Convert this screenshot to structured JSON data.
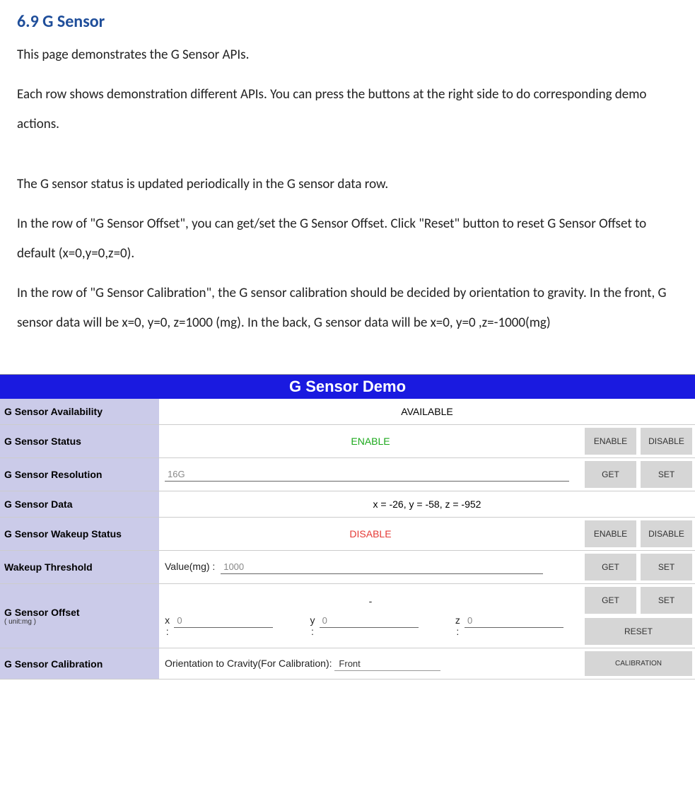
{
  "doc": {
    "heading": "6.9 G Sensor",
    "p1": "This page demonstrates the G Sensor APIs.",
    "p2": "Each row shows demonstration different APIs. You can press the buttons at the right side to do corresponding demo actions.",
    "p3": "The G sensor status is updated periodically in the G sensor data row.",
    "p4": "In the row of \"G Sensor Offset\", you can get/set the G Sensor Offset. Click \"Reset\" button to reset G Sensor Offset to default (x=0,y=0,z=0).",
    "p5": "In the row of \"G Sensor Calibration\", the G sensor calibration should be decided by orientation to gravity. In the front, G sensor data will be x=0, y=0, z=1000 (mg). In the back, G sensor data will be x=0, y=0 ,z=-1000(mg)"
  },
  "demo": {
    "title": "G Sensor Demo",
    "rows": {
      "availability": {
        "label": "G Sensor Availability",
        "value": "AVAILABLE"
      },
      "status": {
        "label": "G Sensor Status",
        "value": "ENABLE",
        "btn1": "ENABLE",
        "btn2": "DISABLE"
      },
      "resolution": {
        "label": "G Sensor Resolution",
        "value": "16G",
        "btn1": "GET",
        "btn2": "SET"
      },
      "data": {
        "label": "G Sensor Data",
        "value": "x = -26, y = -58, z = -952"
      },
      "wakeup": {
        "label": "G Sensor Wakeup Status",
        "value": "DISABLE",
        "btn1": "ENABLE",
        "btn2": "DISABLE"
      },
      "threshold": {
        "label": "Wakeup Threshold",
        "prefix": "Value(mg) :",
        "value": "1000",
        "btn1": "GET",
        "btn2": "SET"
      },
      "offset": {
        "label": "G Sensor Offset",
        "sublabel": "( unit:mg )",
        "dash": "-",
        "x_label": "x :",
        "x_val": "0",
        "y_label": "y :",
        "y_val": "0",
        "z_label": "z :",
        "z_val": "0",
        "btn1": "GET",
        "btn2": "SET",
        "btn3": "RESET"
      },
      "calibration": {
        "label": "G Sensor Calibration",
        "prefix": "Orientation to Cravity(For Calibration):",
        "value": "Front",
        "btn1": "CALIBRATION"
      }
    }
  }
}
